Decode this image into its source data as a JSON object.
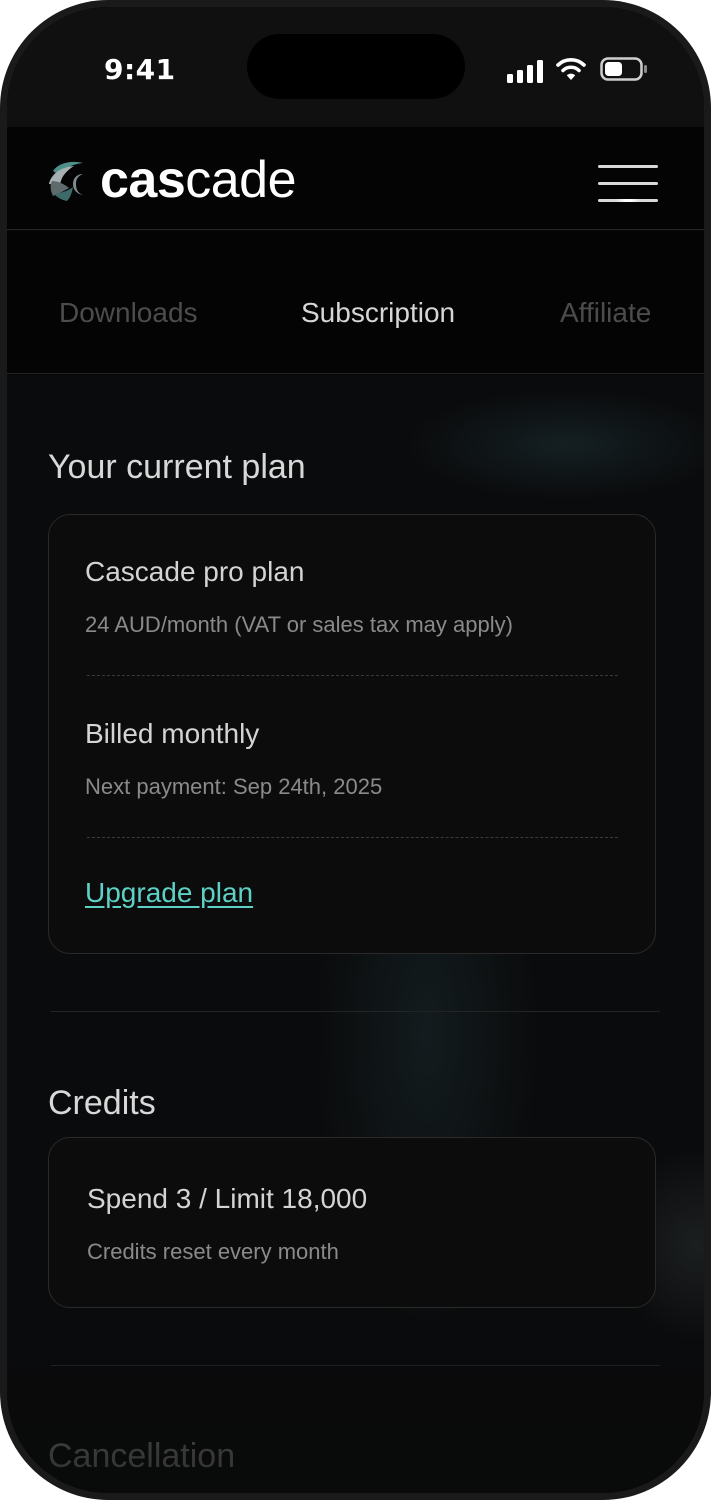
{
  "status_bar": {
    "time": "9:41"
  },
  "header": {
    "logo_bold": "cas",
    "logo_light": "cade"
  },
  "tabs": [
    {
      "label": "Downloads"
    },
    {
      "label": "Subscription",
      "active": true
    },
    {
      "label": "Affiliate"
    }
  ],
  "plan": {
    "section_title": "Your current plan",
    "name": "Cascade pro plan",
    "price": "24 AUD/month (VAT or sales tax may apply)",
    "billing": "Billed monthly",
    "next_payment": "Next payment: Sep 24th, 2025",
    "upgrade_label": "Upgrade plan"
  },
  "credits": {
    "section_title": "Credits",
    "usage": "Spend 3 / Limit 18,000",
    "note": "Credits reset every month"
  },
  "cancellation": {
    "section_title": "Cancellation"
  },
  "colors": {
    "accent": "#5ed1c6",
    "background": "#0a0b0c"
  },
  "icons": [
    "signal-icon",
    "wifi-icon",
    "battery-icon",
    "logo-mark-icon",
    "hamburger-menu-icon"
  ]
}
